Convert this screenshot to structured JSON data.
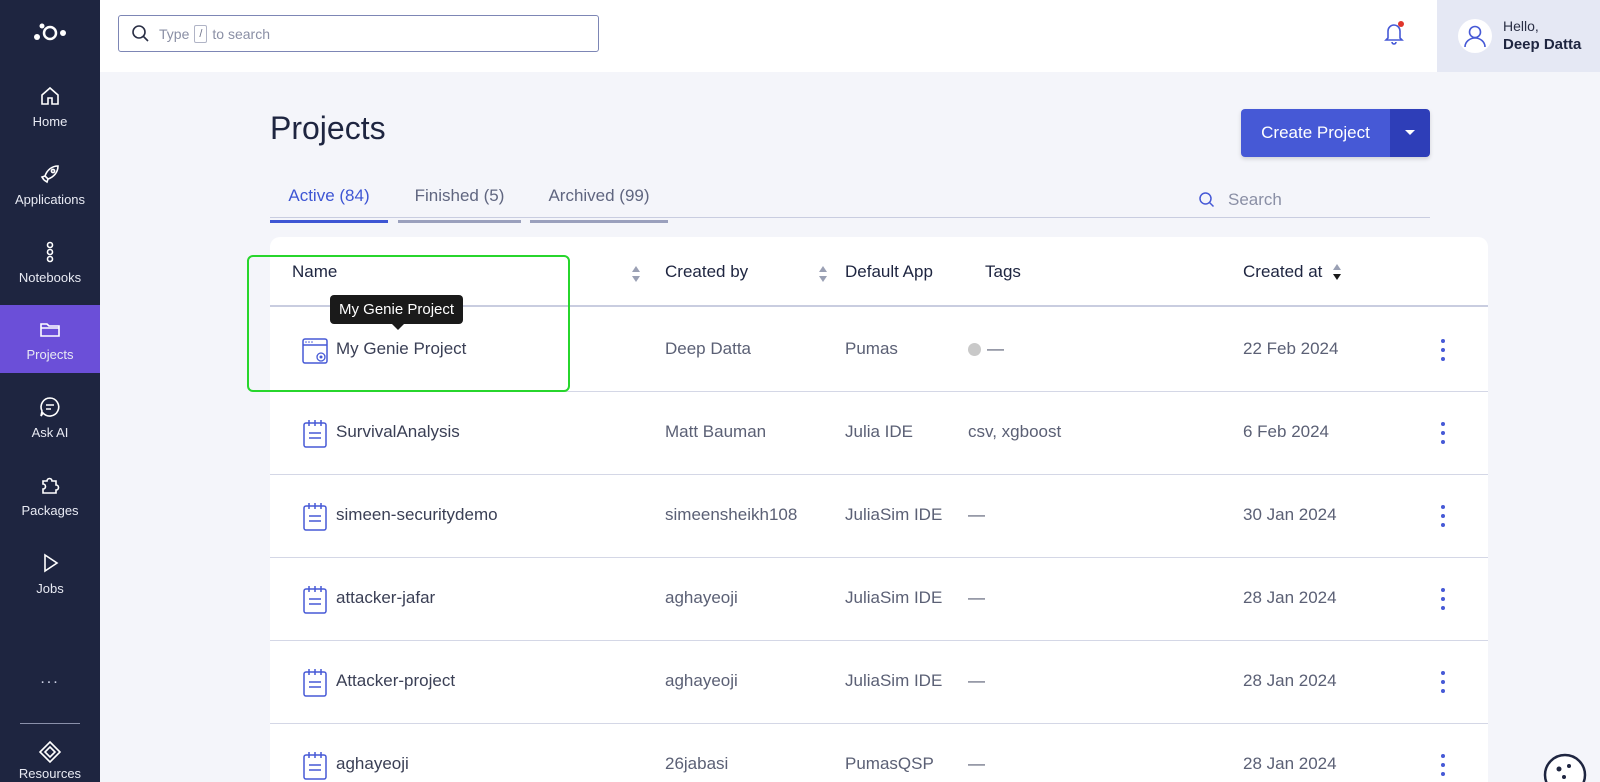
{
  "sidebar": {
    "items": [
      {
        "label": "Home",
        "icon": "home-icon"
      },
      {
        "label": "Applications",
        "icon": "rocket-icon"
      },
      {
        "label": "Notebooks",
        "icon": "notebook-icon"
      },
      {
        "label": "Projects",
        "icon": "folder-icon",
        "active": true
      },
      {
        "label": "Ask AI",
        "icon": "chat-icon"
      },
      {
        "label": "Packages",
        "icon": "puzzle-icon"
      },
      {
        "label": "Jobs",
        "icon": "play-icon"
      }
    ],
    "more": "...",
    "resources_label": "Resources"
  },
  "topbar": {
    "search_prefix": "Type",
    "search_key": "/",
    "search_suffix": "to search",
    "greeting": "Hello,",
    "user_name": "Deep Datta"
  },
  "page": {
    "title": "Projects",
    "create_button": "Create Project",
    "tabs": [
      {
        "label": "Active (84)",
        "active": true
      },
      {
        "label": "Finished (5)"
      },
      {
        "label": "Archived (99)"
      }
    ],
    "search_placeholder": "Search"
  },
  "table": {
    "headers": {
      "name": "Name",
      "created_by": "Created by",
      "default_app": "Default App",
      "tags": "Tags",
      "created_at": "Created at"
    },
    "rows": [
      {
        "name": "My Genie Project",
        "created_by": "Deep Datta",
        "default_app": "Pumas",
        "tags": "—",
        "created_at": "22 Feb 2024",
        "icon": "genie-project-icon"
      },
      {
        "name": "SurvivalAnalysis",
        "created_by": "Matt Bauman",
        "default_app": "Julia IDE",
        "tags": "csv, xgboost",
        "created_at": "6 Feb 2024",
        "icon": "notepad-icon"
      },
      {
        "name": "simeen-securitydemo",
        "created_by": "simeensheikh108",
        "default_app": "JuliaSim IDE",
        "tags": "—",
        "created_at": "30 Jan 2024",
        "icon": "notepad-icon"
      },
      {
        "name": "attacker-jafar",
        "created_by": "aghayeoji",
        "default_app": "JuliaSim IDE",
        "tags": "—",
        "created_at": "28 Jan 2024",
        "icon": "notepad-icon"
      },
      {
        "name": "Attacker-project",
        "created_by": "aghayeoji",
        "default_app": "JuliaSim IDE",
        "tags": "—",
        "created_at": "28 Jan 2024",
        "icon": "notepad-icon"
      },
      {
        "name": "aghayeoji",
        "created_by": "26jabasi",
        "default_app": "PumasQSP",
        "tags": "—",
        "created_at": "28 Jan 2024",
        "icon": "notepad-icon"
      }
    ]
  },
  "tooltip": "My Genie Project",
  "colors": {
    "sidebar_bg": "#1e2540",
    "sidebar_active": "#6b4fd8",
    "primary": "#4659d6",
    "highlight": "#27d62c"
  }
}
